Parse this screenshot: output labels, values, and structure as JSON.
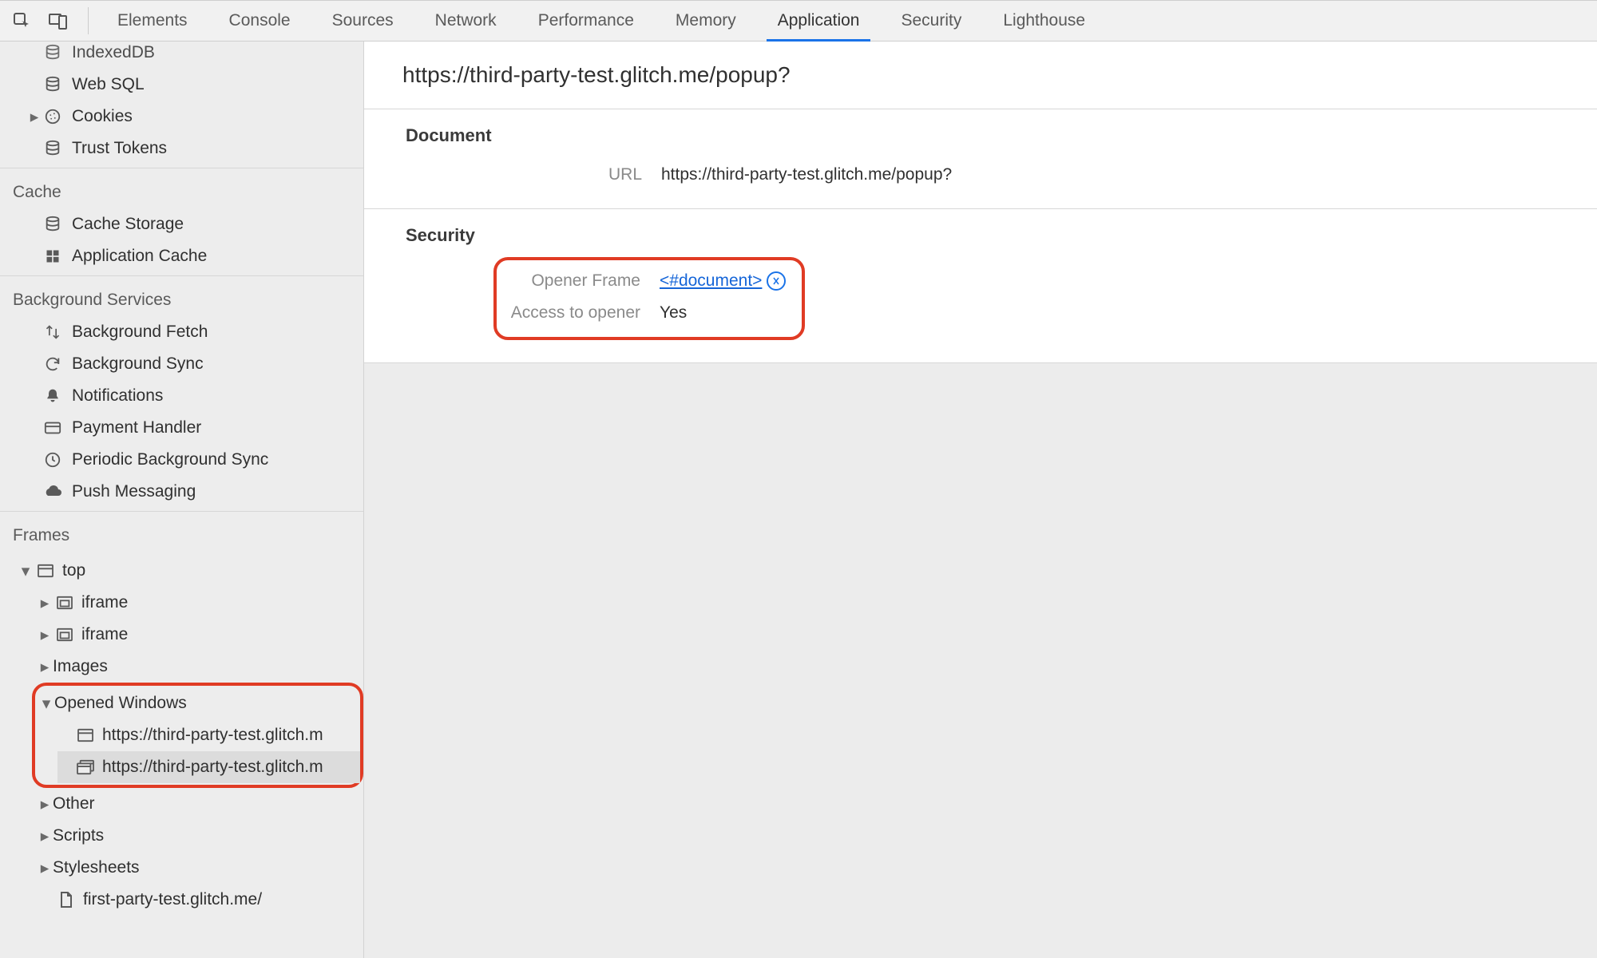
{
  "tabs": {
    "items": [
      "Elements",
      "Console",
      "Sources",
      "Network",
      "Performance",
      "Memory",
      "Application",
      "Security",
      "Lighthouse"
    ],
    "active": "Application"
  },
  "sidebar": {
    "storage_partial": {
      "indexeddb": "IndexedDB",
      "websql": "Web SQL",
      "cookies": "Cookies",
      "trust_tokens": "Trust Tokens"
    },
    "cache": {
      "heading": "Cache",
      "cache_storage": "Cache Storage",
      "app_cache": "Application Cache"
    },
    "bg": {
      "heading": "Background Services",
      "bg_fetch": "Background Fetch",
      "bg_sync": "Background Sync",
      "notifications": "Notifications",
      "payment": "Payment Handler",
      "periodic": "Periodic Background Sync",
      "push": "Push Messaging"
    },
    "frames": {
      "heading": "Frames",
      "top": "top",
      "iframe1": "iframe",
      "iframe2": "iframe",
      "images": "Images",
      "opened": "Opened Windows",
      "win1": "https://third-party-test.glitch.m",
      "win2": "https://third-party-test.glitch.m",
      "other": "Other",
      "scripts": "Scripts",
      "stylesheets": "Stylesheets",
      "file1": "first-party-test.glitch.me/"
    }
  },
  "content": {
    "page_title": "https://third-party-test.glitch.me/popup?",
    "document": {
      "heading": "Document",
      "url_label": "URL",
      "url_value": "https://third-party-test.glitch.me/popup?"
    },
    "security": {
      "heading": "Security",
      "opener_frame_label": "Opener Frame",
      "opener_frame_value": "<#document>",
      "access_label": "Access to opener",
      "access_value": "Yes"
    }
  }
}
